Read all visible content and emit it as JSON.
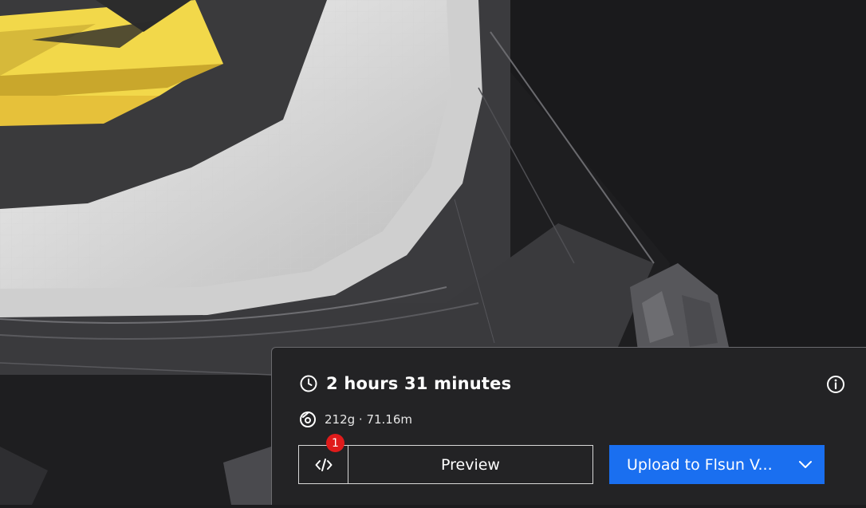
{
  "viewport": {
    "description_icon": "3d-print-bed-view"
  },
  "print_summary": {
    "duration": "2 hours 31 minutes",
    "material": "212g · 71.16m",
    "icons": {
      "time": "clock-icon",
      "material": "filament-spool-icon",
      "info": "info-icon"
    }
  },
  "actions": {
    "gcode_badge": "1",
    "gcode_icon": "code-icon",
    "preview_label": "Preview",
    "upload_label": "Upload to Flsun V...",
    "upload_color": "#1a6ff0"
  }
}
